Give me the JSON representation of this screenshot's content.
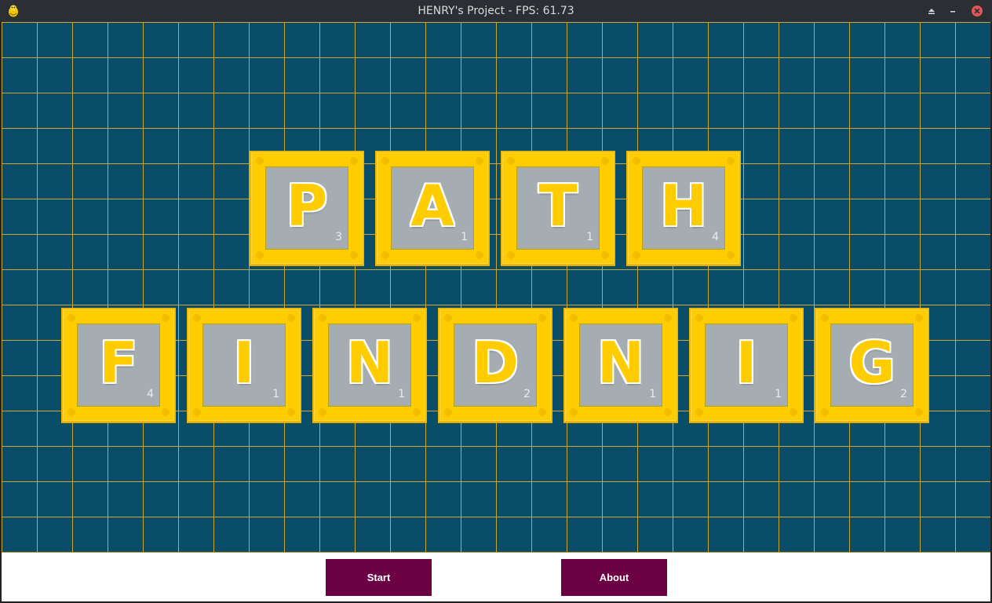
{
  "window": {
    "title": "HENRY's Project - FPS: 61.73",
    "icon": "pygame-snake-icon",
    "controls": [
      "maximize-icon",
      "minimize-icon",
      "close-icon"
    ]
  },
  "colors": {
    "grid_background": "#0a4d68",
    "grid_lines": "#c9a93a",
    "tile_border": "#ffcc00",
    "tile_face": "#a5adb3",
    "button": "#6b0043"
  },
  "title_rows": [
    {
      "word": "PATH",
      "tiles": [
        {
          "letter": "P",
          "score": "3"
        },
        {
          "letter": "A",
          "score": "1"
        },
        {
          "letter": "T",
          "score": "1"
        },
        {
          "letter": "H",
          "score": "4"
        }
      ]
    },
    {
      "word": "FINDNIG",
      "tiles": [
        {
          "letter": "F",
          "score": "4"
        },
        {
          "letter": "I",
          "score": "1"
        },
        {
          "letter": "N",
          "score": "1"
        },
        {
          "letter": "D",
          "score": "2"
        },
        {
          "letter": "N",
          "score": "1"
        },
        {
          "letter": "I",
          "score": "1"
        },
        {
          "letter": "G",
          "score": "2"
        }
      ]
    }
  ],
  "buttons": {
    "start_label": "Start",
    "about_label": "About"
  }
}
